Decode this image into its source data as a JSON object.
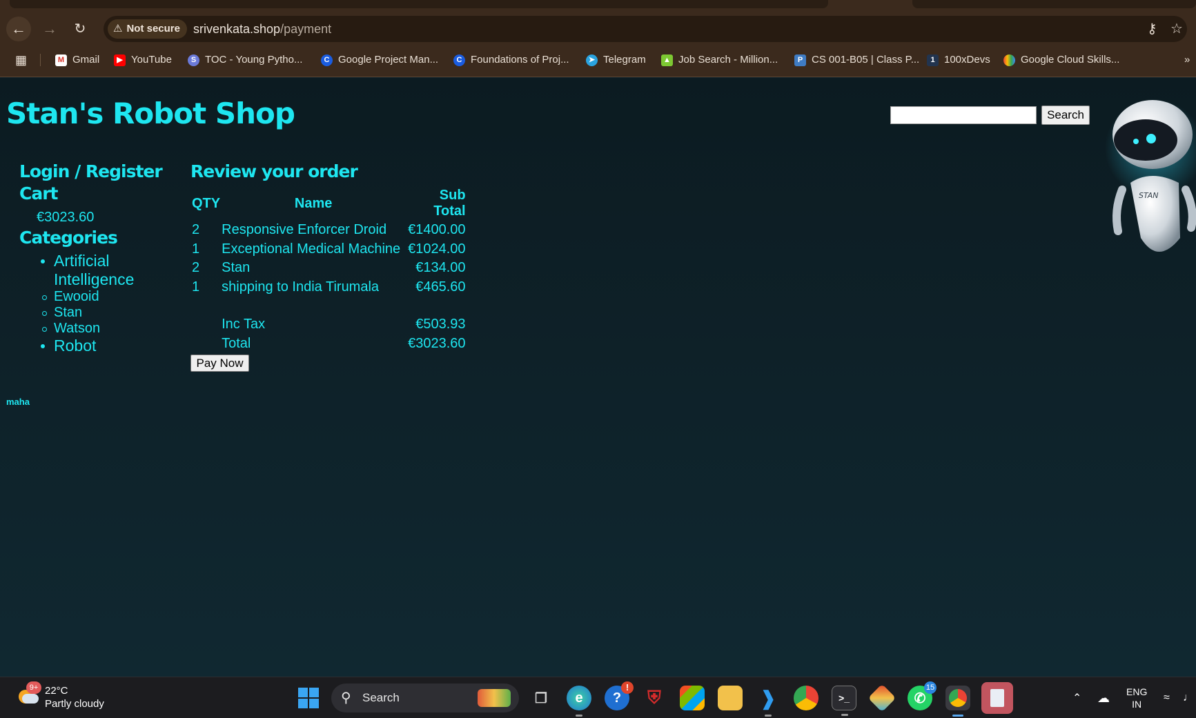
{
  "browser": {
    "security_label": "Not secure",
    "url_host": "srivenkata.shop",
    "url_path": "/payment",
    "bookmarks": [
      {
        "label": "Gmail",
        "icon": "gmail-icon"
      },
      {
        "label": "YouTube",
        "icon": "youtube-icon"
      },
      {
        "label": "TOC - Young Pytho...",
        "icon": "toc-icon"
      },
      {
        "label": "Google Project Man...",
        "icon": "coursera-icon"
      },
      {
        "label": "Foundations of Proj...",
        "icon": "coursera-icon"
      },
      {
        "label": "Telegram",
        "icon": "telegram-icon"
      },
      {
        "label": "Job Search - Million...",
        "icon": "job-search-icon"
      },
      {
        "label": "CS 001-B05 | Class P...",
        "icon": "piazza-icon"
      },
      {
        "label": "100xDevs",
        "icon": "100xdevs-icon"
      },
      {
        "label": "Google Cloud Skills...",
        "icon": "google-cloud-icon"
      }
    ]
  },
  "shop": {
    "title": "Stan's Robot Shop",
    "search_button": "Search",
    "search_value": "",
    "sidebar": {
      "login": "Login / Register",
      "cart_heading": "Cart",
      "cart_total": "€3023.60",
      "categories_heading": "Categories",
      "categories": [
        {
          "label": "Artificial Intelligence",
          "children": [
            "Ewooid",
            "Stan",
            "Watson"
          ]
        },
        {
          "label": "Robot",
          "children": []
        }
      ]
    },
    "review": {
      "heading": "Review your order",
      "columns": {
        "qty": "QTY",
        "name": "Name",
        "subtotal": "Sub Total"
      },
      "items": [
        {
          "qty": "2",
          "name": "Responsive Enforcer Droid",
          "subtotal": "€1400.00"
        },
        {
          "qty": "1",
          "name": "Exceptional Medical Machine",
          "subtotal": "€1024.00"
        },
        {
          "qty": "2",
          "name": "Stan",
          "subtotal": "€134.00"
        },
        {
          "qty": "1",
          "name": "shipping to India Tirumala",
          "subtotal": "€465.60"
        }
      ],
      "tax_label": "Inc Tax",
      "tax_value": "€503.93",
      "total_label": "Total",
      "total_value": "€3023.60",
      "pay_button": "Pay Now"
    },
    "footer_note": "maha",
    "robot_badge": "STAN"
  },
  "taskbar": {
    "weather_temp": "22°C",
    "weather_desc": "Partly cloudy",
    "weather_badge": "9+",
    "search_label": "Search",
    "whatsapp_badge": "15",
    "lang_line1": "ENG",
    "lang_line2": "IN"
  },
  "colors": {
    "accent": "#1ee6f0",
    "page_bg": "#0f2229",
    "chrome_bg": "#3b2a1d"
  }
}
